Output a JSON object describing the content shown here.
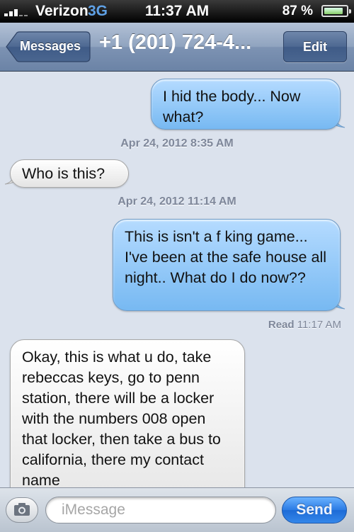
{
  "status_bar": {
    "carrier": "Verizon",
    "network": "3G",
    "time": "11:37 AM",
    "battery_percent_label": "87 %",
    "battery_level": 0.87
  },
  "nav": {
    "back_label": "Messages",
    "title": "+1 (201) 724-4...",
    "edit_label": "Edit"
  },
  "messages": [
    {
      "direction": "outgoing",
      "text": "I hid the body... Now what?"
    },
    {
      "type": "timestamp",
      "text": "Apr 24, 2012 8:35 AM"
    },
    {
      "direction": "incoming",
      "text": "Who is this?"
    },
    {
      "type": "timestamp",
      "text": "Apr 24, 2012 11:14 AM"
    },
    {
      "direction": "outgoing",
      "text": "This is isn't a f king game... I've been at the safe house all night.. What do I do now??"
    },
    {
      "type": "receipt",
      "label": "Read",
      "time": "11:17 AM"
    },
    {
      "direction": "incoming",
      "text": "Okay, this is what u do, take rebeccas keys, go to penn station, there will be a locker with the numbers 008 open that locker, then take a bus to california, there my contact name"
    }
  ],
  "input": {
    "placeholder": "iMessage",
    "send_label": "Send"
  },
  "colors": {
    "outgoing_bubble": "#8ec6f7",
    "incoming_bubble": "#f0f0f0",
    "background": "#dbe2ed",
    "navbar": "#7d93b3",
    "send_button": "#2a7ae4"
  },
  "icons": {
    "camera": "camera-icon",
    "signal": "signal-bars-icon",
    "battery": "battery-icon"
  }
}
